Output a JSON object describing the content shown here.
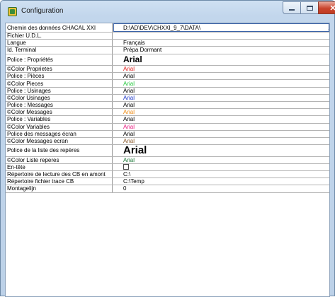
{
  "window": {
    "title": "Configuration"
  },
  "rows": [
    {
      "label": "Chemin des données CHACAL XXI",
      "value": "D:\\AD\\DEV\\CHXXI_9_7\\DATA\\",
      "color": "#000000",
      "kind": "path"
    },
    {
      "label": "Fichier U.D.L.",
      "value": "",
      "color": "#000000",
      "kind": "normal"
    },
    {
      "label": "Langue",
      "value": "Français",
      "color": "#000000",
      "kind": "normal"
    },
    {
      "label": "Id. Terminal",
      "value": "Prépa Dormant",
      "color": "#000000",
      "kind": "normal"
    },
    {
      "label": "Police : Propriétés",
      "value": "Arial",
      "color": "#000000",
      "kind": "big"
    },
    {
      "label": "©Color Proprietes",
      "value": "Arial",
      "color": "#e0201d",
      "kind": "normal"
    },
    {
      "label": "Police : Pièces",
      "value": "Arial",
      "color": "#000000",
      "kind": "normal"
    },
    {
      "label": "©Color Pieces",
      "value": "Arial",
      "color": "#27c93f",
      "kind": "normal"
    },
    {
      "label": "Police : Usinages",
      "value": "Arial",
      "color": "#000000",
      "kind": "normal"
    },
    {
      "label": "©Color Usinages",
      "value": "Arial",
      "color": "#1b35c8",
      "kind": "normal"
    },
    {
      "label": "Police : Messages",
      "value": "Arial",
      "color": "#000000",
      "kind": "normal"
    },
    {
      "label": "©Color Messages",
      "value": "Arial",
      "color": "#ee8a12",
      "kind": "normal"
    },
    {
      "label": "Police : Variables",
      "value": "Arial",
      "color": "#000000",
      "kind": "normal"
    },
    {
      "label": "©Color Variables",
      "value": "Arial",
      "color": "#e8187f",
      "kind": "normal"
    },
    {
      "label": "Police des messages écran",
      "value": "Arial",
      "color": "#000000",
      "kind": "normal"
    },
    {
      "label": "©Color Messages ecran",
      "value": "Arial",
      "color": "#8a5a2b",
      "kind": "normal"
    },
    {
      "label": "Police de la liste des repères",
      "value": "Arial",
      "color": "#000000",
      "kind": "bigger"
    },
    {
      "label": "©Color Liste reperes",
      "value": "Arial",
      "color": "#1f7a3a",
      "kind": "normal"
    },
    {
      "label": "En-tête",
      "value": "",
      "color": "#000000",
      "kind": "checkbox"
    },
    {
      "label": "Répertoire de lecture des CB en amont",
      "value": "C:\\",
      "color": "#000000",
      "kind": "normal"
    },
    {
      "label": "Répertoire fichier trace CB",
      "value": "C:\\Temp",
      "color": "#000000",
      "kind": "normal"
    },
    {
      "label": "Montagelijn",
      "value": "0",
      "color": "#000000",
      "kind": "normal"
    }
  ],
  "ellipsis_label": "..."
}
